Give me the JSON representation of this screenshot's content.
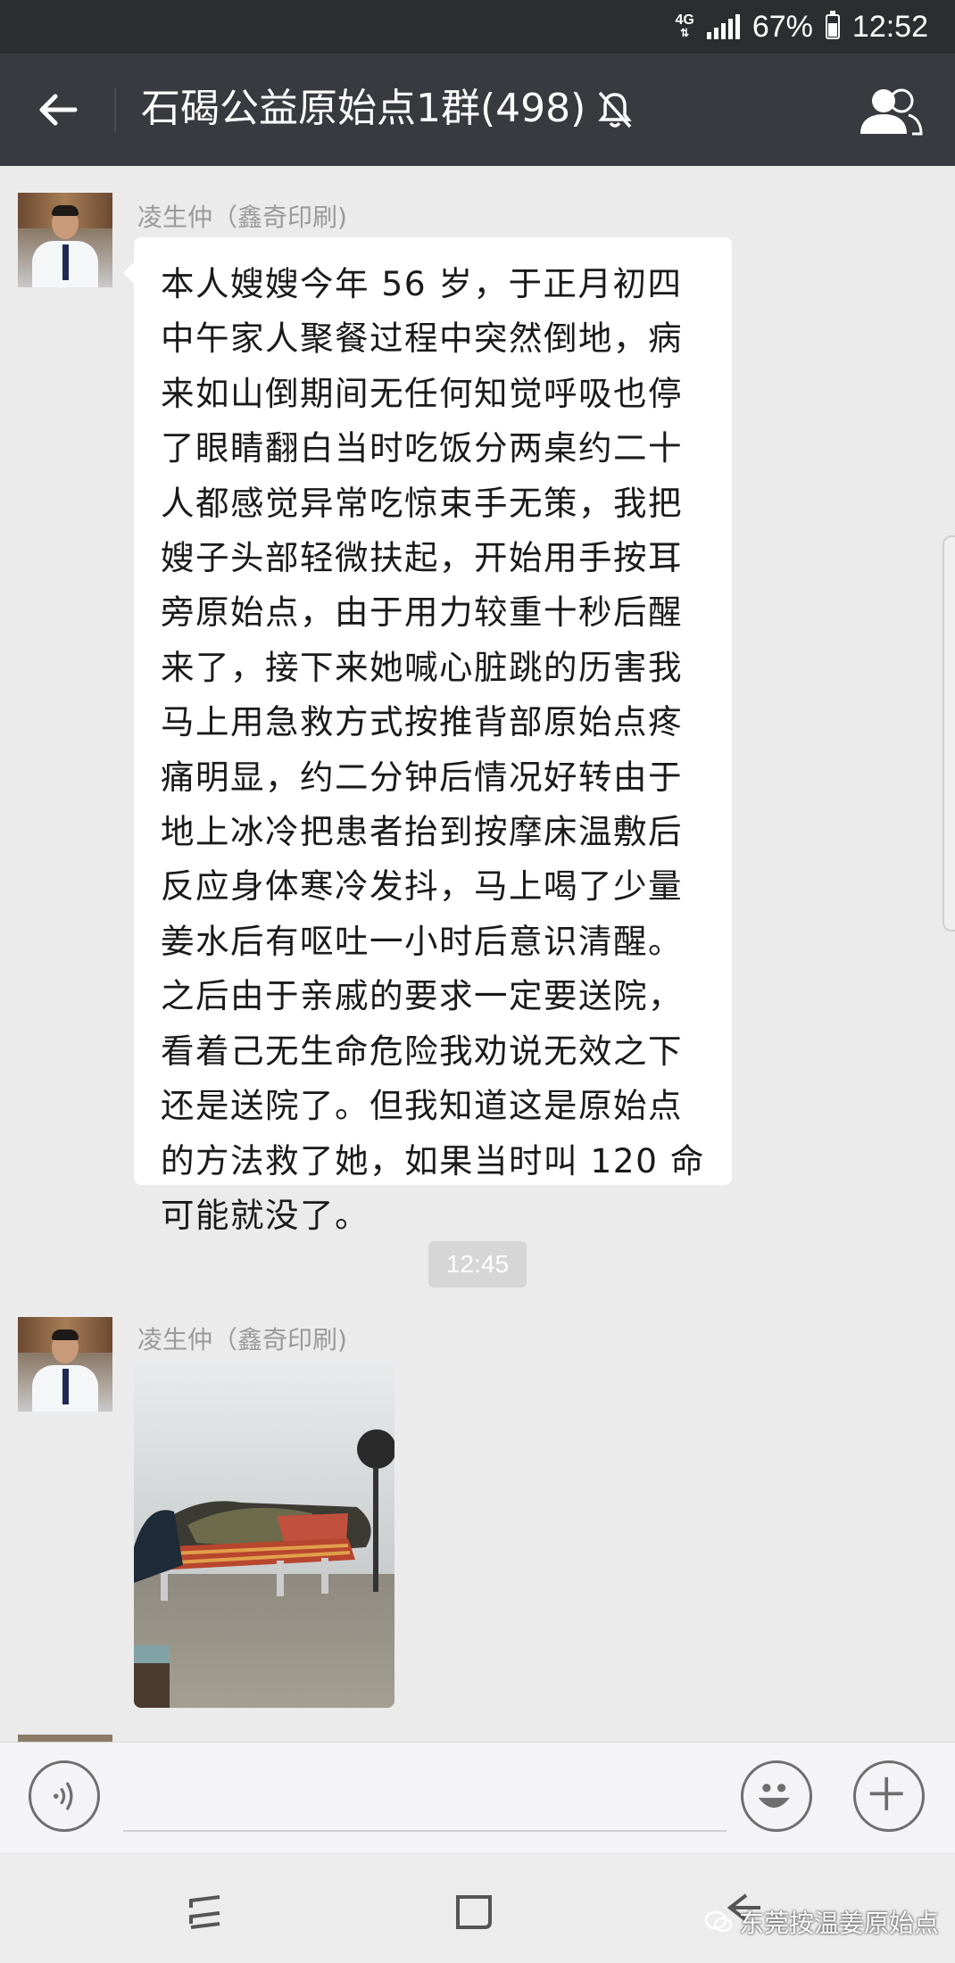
{
  "status_bar": {
    "network": "4G",
    "battery": "67%",
    "battery_level": 0.67,
    "time": "12:52"
  },
  "header": {
    "title": "石碣公益原始点1群(498)",
    "icons": [
      "back-icon",
      "mute-bell-icon",
      "group-members-icon"
    ]
  },
  "messages": [
    {
      "sender": "凌生仲（鑫奇印刷)",
      "type": "text",
      "text": "本人嫂嫂今年 56 岁，于正月初四中午家人聚餐过程中突然倒地，病来如山倒期间无任何知觉呼吸也停了眼睛翻白当时吃饭分两桌约二十人都感觉异常吃惊束手无策，我把嫂子头部轻微扶起，开始用手按耳旁原始点，由于用力较重十秒后醒来了，接下来她喊心脏跳的历害我马上用急救方式按推背部原始点疼痛明显，约二分钟后情况好转由于地上冰冷把患者抬到按摩床温敷后反应身体寒冷发抖，马上喝了少量姜水后有呕吐一小时后意识清醒。之后由于亲戚的要求一定要送院，看着己无生命危险我劝说无效之下还是送院了。但我知道这是原始点的方法救了她，如果当时叫 120 命可能就没了。"
    },
    {
      "type": "timestamp",
      "text": "12:45"
    },
    {
      "sender": "凌生仲（鑫奇印刷)",
      "type": "image"
    }
  ],
  "input_bar": {
    "icons": [
      "voice-icon",
      "emoji-icon",
      "plus-icon"
    ]
  },
  "nav_bar": {
    "icons": [
      "recent-apps-icon",
      "home-icon",
      "back-nav-icon"
    ]
  },
  "watermark": {
    "text": "东莞按温姜原始点"
  },
  "colors": {
    "header_bg": "#393a3f",
    "status_bg": "#2b2d2f",
    "chat_bg": "#ebebeb",
    "bubble_bg": "#ffffff"
  }
}
